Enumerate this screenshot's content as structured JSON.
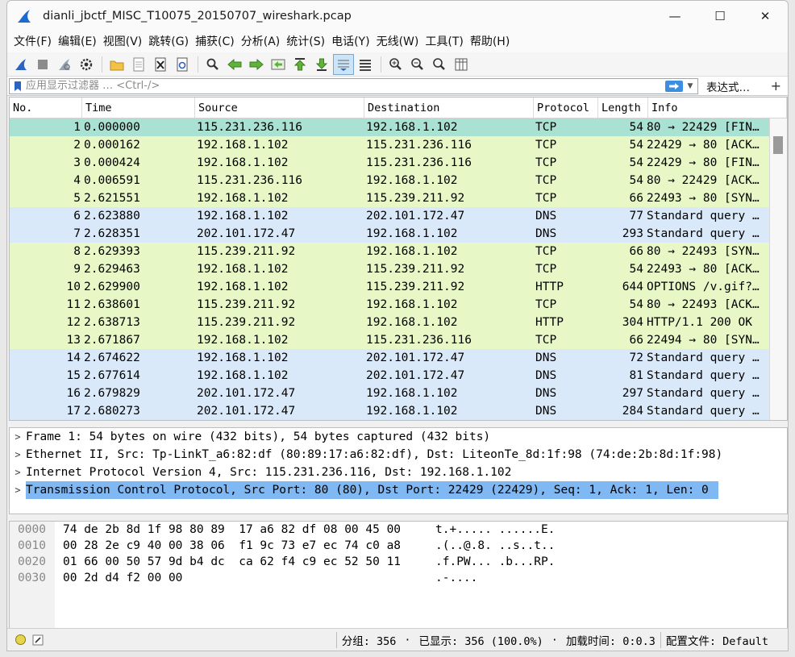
{
  "window": {
    "title": "dianli_jbctf_MISC_T10075_20150707_wireshark.pcap",
    "minimize": "—",
    "maximize": "☐",
    "close": "✕"
  },
  "menu": [
    "文件(F)",
    "编辑(E)",
    "视图(V)",
    "跳转(G)",
    "捕获(C)",
    "分析(A)",
    "统计(S)",
    "电话(Y)",
    "无线(W)",
    "工具(T)",
    "帮助(H)"
  ],
  "filter": {
    "placeholder": "应用显示过滤器 … <Ctrl-/>",
    "expression_label": "表达式…",
    "add_label": "+"
  },
  "columns": [
    "No.",
    "Time",
    "Source",
    "Destination",
    "Protocol",
    "Length",
    "Info"
  ],
  "packets": [
    {
      "no": "1",
      "time": "0.000000",
      "src": "115.231.236.116",
      "dst": "192.168.1.102",
      "proto": "TCP",
      "len": "54",
      "info": "80 → 22429 [FIN…"
    },
    {
      "no": "2",
      "time": "0.000162",
      "src": "192.168.1.102",
      "dst": "115.231.236.116",
      "proto": "TCP",
      "len": "54",
      "info": "22429 → 80 [ACK…"
    },
    {
      "no": "3",
      "time": "0.000424",
      "src": "192.168.1.102",
      "dst": "115.231.236.116",
      "proto": "TCP",
      "len": "54",
      "info": "22429 → 80 [FIN…"
    },
    {
      "no": "4",
      "time": "0.006591",
      "src": "115.231.236.116",
      "dst": "192.168.1.102",
      "proto": "TCP",
      "len": "54",
      "info": "80 → 22429 [ACK…"
    },
    {
      "no": "5",
      "time": "2.621551",
      "src": "192.168.1.102",
      "dst": "115.239.211.92",
      "proto": "TCP",
      "len": "66",
      "info": "22493 → 80 [SYN…"
    },
    {
      "no": "6",
      "time": "2.623880",
      "src": "192.168.1.102",
      "dst": "202.101.172.47",
      "proto": "DNS",
      "len": "77",
      "info": "Standard query …"
    },
    {
      "no": "7",
      "time": "2.628351",
      "src": "202.101.172.47",
      "dst": "192.168.1.102",
      "proto": "DNS",
      "len": "293",
      "info": "Standard query …"
    },
    {
      "no": "8",
      "time": "2.629393",
      "src": "115.239.211.92",
      "dst": "192.168.1.102",
      "proto": "TCP",
      "len": "66",
      "info": "80 → 22493 [SYN…"
    },
    {
      "no": "9",
      "time": "2.629463",
      "src": "192.168.1.102",
      "dst": "115.239.211.92",
      "proto": "TCP",
      "len": "54",
      "info": "22493 → 80 [ACK…"
    },
    {
      "no": "10",
      "time": "2.629900",
      "src": "192.168.1.102",
      "dst": "115.239.211.92",
      "proto": "HTTP",
      "len": "644",
      "info": "OPTIONS /v.gif?…"
    },
    {
      "no": "11",
      "time": "2.638601",
      "src": "115.239.211.92",
      "dst": "192.168.1.102",
      "proto": "TCP",
      "len": "54",
      "info": "80 → 22493 [ACK…"
    },
    {
      "no": "12",
      "time": "2.638713",
      "src": "115.239.211.92",
      "dst": "192.168.1.102",
      "proto": "HTTP",
      "len": "304",
      "info": "HTTP/1.1 200 OK"
    },
    {
      "no": "13",
      "time": "2.671867",
      "src": "192.168.1.102",
      "dst": "115.231.236.116",
      "proto": "TCP",
      "len": "66",
      "info": "22494 → 80 [SYN…"
    },
    {
      "no": "14",
      "time": "2.674622",
      "src": "192.168.1.102",
      "dst": "202.101.172.47",
      "proto": "DNS",
      "len": "72",
      "info": "Standard query …"
    },
    {
      "no": "15",
      "time": "2.677614",
      "src": "192.168.1.102",
      "dst": "202.101.172.47",
      "proto": "DNS",
      "len": "81",
      "info": "Standard query …"
    },
    {
      "no": "16",
      "time": "2.679829",
      "src": "202.101.172.47",
      "dst": "192.168.1.102",
      "proto": "DNS",
      "len": "297",
      "info": "Standard query …"
    },
    {
      "no": "17",
      "time": "2.680273",
      "src": "202.101.172.47",
      "dst": "192.168.1.102",
      "proto": "DNS",
      "len": "284",
      "info": "Standard query …"
    }
  ],
  "details": [
    "Frame 1: 54 bytes on wire (432 bits), 54 bytes captured (432 bits)",
    "Ethernet II, Src: Tp-LinkT_a6:82:df (80:89:17:a6:82:df), Dst: LiteonTe_8d:1f:98 (74:de:2b:8d:1f:98)",
    "Internet Protocol Version 4, Src: 115.231.236.116, Dst: 192.168.1.102",
    "Transmission Control Protocol, Src Port: 80 (80), Dst Port: 22429 (22429), Seq: 1, Ack: 1, Len: 0"
  ],
  "bytes": {
    "offsets": [
      "0000",
      "0010",
      "0020",
      "0030"
    ],
    "hex": [
      "74 de 2b 8d 1f 98 80 89  17 a6 82 df 08 00 45 00",
      "00 28 2e c9 40 00 38 06  f1 9c 73 e7 ec 74 c0 a8",
      "01 66 00 50 57 9d b4 dc  ca 62 f4 c9 ec 52 50 11",
      "00 2d d4 f2 00 00"
    ],
    "ascii": [
      "t.+..... ......E.",
      ".(..@.8. ..s..t..",
      ".f.PW... .b...RP.",
      ".-...."
    ]
  },
  "status": {
    "packets": "分组: 356",
    "displayed": "已显示: 356 (100.0%)",
    "load_time": "加载时间: 0:0.3",
    "profile": "配置文件: Default"
  },
  "colors": {
    "tcp_row": "#e7f8c6",
    "dns_row": "#dae9f9",
    "selected_row": "#a9e2d2",
    "selected_detail": "#7fb8f2"
  }
}
